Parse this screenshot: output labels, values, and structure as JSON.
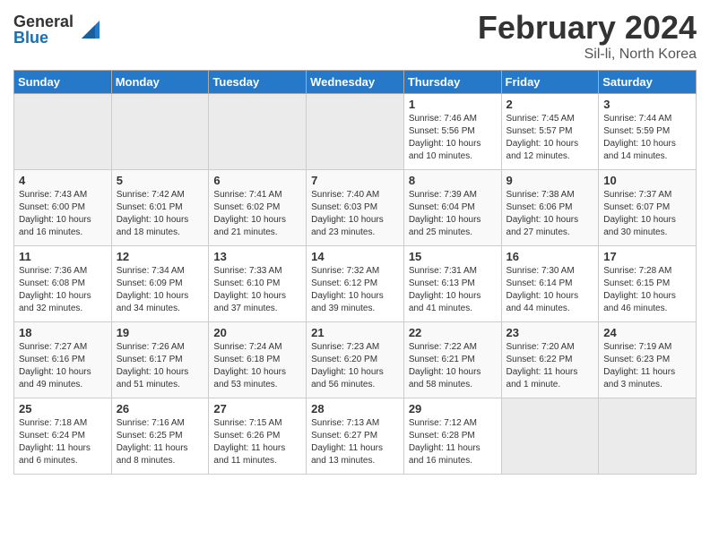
{
  "header": {
    "logo_general": "General",
    "logo_blue": "Blue",
    "main_title": "February 2024",
    "sub_title": "Sil-li, North Korea"
  },
  "weekdays": [
    "Sunday",
    "Monday",
    "Tuesday",
    "Wednesday",
    "Thursday",
    "Friday",
    "Saturday"
  ],
  "weeks": [
    [
      {
        "day": "",
        "info": "",
        "empty": true
      },
      {
        "day": "",
        "info": "",
        "empty": true
      },
      {
        "day": "",
        "info": "",
        "empty": true
      },
      {
        "day": "",
        "info": "",
        "empty": true
      },
      {
        "day": "1",
        "info": "Sunrise: 7:46 AM\nSunset: 5:56 PM\nDaylight: 10 hours\nand 10 minutes."
      },
      {
        "day": "2",
        "info": "Sunrise: 7:45 AM\nSunset: 5:57 PM\nDaylight: 10 hours\nand 12 minutes."
      },
      {
        "day": "3",
        "info": "Sunrise: 7:44 AM\nSunset: 5:59 PM\nDaylight: 10 hours\nand 14 minutes."
      }
    ],
    [
      {
        "day": "4",
        "info": "Sunrise: 7:43 AM\nSunset: 6:00 PM\nDaylight: 10 hours\nand 16 minutes."
      },
      {
        "day": "5",
        "info": "Sunrise: 7:42 AM\nSunset: 6:01 PM\nDaylight: 10 hours\nand 18 minutes."
      },
      {
        "day": "6",
        "info": "Sunrise: 7:41 AM\nSunset: 6:02 PM\nDaylight: 10 hours\nand 21 minutes."
      },
      {
        "day": "7",
        "info": "Sunrise: 7:40 AM\nSunset: 6:03 PM\nDaylight: 10 hours\nand 23 minutes."
      },
      {
        "day": "8",
        "info": "Sunrise: 7:39 AM\nSunset: 6:04 PM\nDaylight: 10 hours\nand 25 minutes."
      },
      {
        "day": "9",
        "info": "Sunrise: 7:38 AM\nSunset: 6:06 PM\nDaylight: 10 hours\nand 27 minutes."
      },
      {
        "day": "10",
        "info": "Sunrise: 7:37 AM\nSunset: 6:07 PM\nDaylight: 10 hours\nand 30 minutes."
      }
    ],
    [
      {
        "day": "11",
        "info": "Sunrise: 7:36 AM\nSunset: 6:08 PM\nDaylight: 10 hours\nand 32 minutes."
      },
      {
        "day": "12",
        "info": "Sunrise: 7:34 AM\nSunset: 6:09 PM\nDaylight: 10 hours\nand 34 minutes."
      },
      {
        "day": "13",
        "info": "Sunrise: 7:33 AM\nSunset: 6:10 PM\nDaylight: 10 hours\nand 37 minutes."
      },
      {
        "day": "14",
        "info": "Sunrise: 7:32 AM\nSunset: 6:12 PM\nDaylight: 10 hours\nand 39 minutes."
      },
      {
        "day": "15",
        "info": "Sunrise: 7:31 AM\nSunset: 6:13 PM\nDaylight: 10 hours\nand 41 minutes."
      },
      {
        "day": "16",
        "info": "Sunrise: 7:30 AM\nSunset: 6:14 PM\nDaylight: 10 hours\nand 44 minutes."
      },
      {
        "day": "17",
        "info": "Sunrise: 7:28 AM\nSunset: 6:15 PM\nDaylight: 10 hours\nand 46 minutes."
      }
    ],
    [
      {
        "day": "18",
        "info": "Sunrise: 7:27 AM\nSunset: 6:16 PM\nDaylight: 10 hours\nand 49 minutes."
      },
      {
        "day": "19",
        "info": "Sunrise: 7:26 AM\nSunset: 6:17 PM\nDaylight: 10 hours\nand 51 minutes."
      },
      {
        "day": "20",
        "info": "Sunrise: 7:24 AM\nSunset: 6:18 PM\nDaylight: 10 hours\nand 53 minutes."
      },
      {
        "day": "21",
        "info": "Sunrise: 7:23 AM\nSunset: 6:20 PM\nDaylight: 10 hours\nand 56 minutes."
      },
      {
        "day": "22",
        "info": "Sunrise: 7:22 AM\nSunset: 6:21 PM\nDaylight: 10 hours\nand 58 minutes."
      },
      {
        "day": "23",
        "info": "Sunrise: 7:20 AM\nSunset: 6:22 PM\nDaylight: 11 hours\nand 1 minute."
      },
      {
        "day": "24",
        "info": "Sunrise: 7:19 AM\nSunset: 6:23 PM\nDaylight: 11 hours\nand 3 minutes."
      }
    ],
    [
      {
        "day": "25",
        "info": "Sunrise: 7:18 AM\nSunset: 6:24 PM\nDaylight: 11 hours\nand 6 minutes."
      },
      {
        "day": "26",
        "info": "Sunrise: 7:16 AM\nSunset: 6:25 PM\nDaylight: 11 hours\nand 8 minutes."
      },
      {
        "day": "27",
        "info": "Sunrise: 7:15 AM\nSunset: 6:26 PM\nDaylight: 11 hours\nand 11 minutes."
      },
      {
        "day": "28",
        "info": "Sunrise: 7:13 AM\nSunset: 6:27 PM\nDaylight: 11 hours\nand 13 minutes."
      },
      {
        "day": "29",
        "info": "Sunrise: 7:12 AM\nSunset: 6:28 PM\nDaylight: 11 hours\nand 16 minutes."
      },
      {
        "day": "",
        "info": "",
        "empty": true
      },
      {
        "day": "",
        "info": "",
        "empty": true
      }
    ]
  ]
}
